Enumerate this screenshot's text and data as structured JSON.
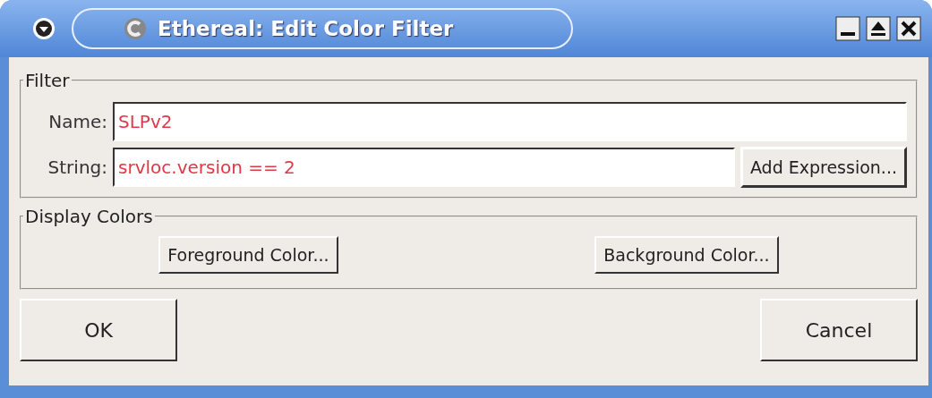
{
  "window": {
    "title": "Ethereal: Edit Color Filter"
  },
  "filter": {
    "legend": "Filter",
    "name": {
      "label": "Name:",
      "value": "SLPv2"
    },
    "string": {
      "label": "String:",
      "value": "srvloc.version == 2"
    },
    "add_expression": "Add Expression..."
  },
  "display_colors": {
    "legend": "Display Colors",
    "buttons": [
      "Foreground Color...",
      "Background Color..."
    ]
  },
  "buttons": [
    "OK",
    "Cancel"
  ]
}
